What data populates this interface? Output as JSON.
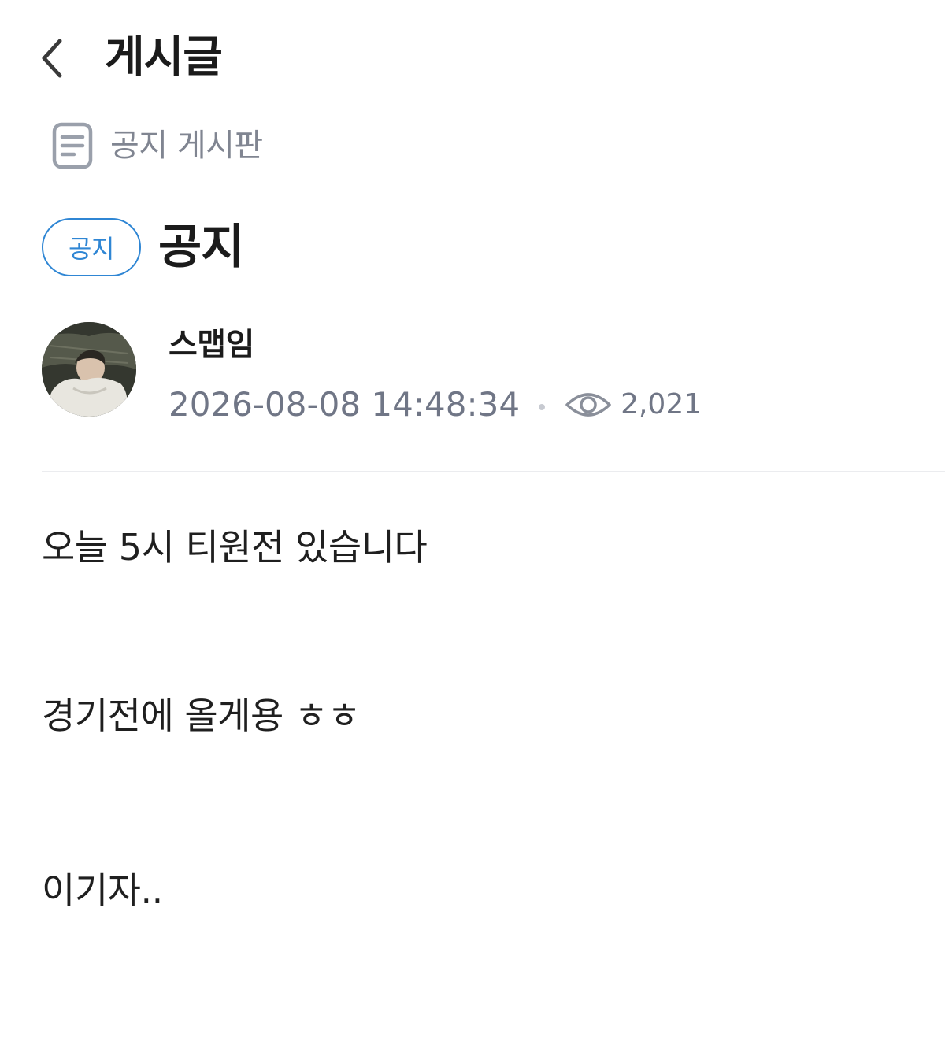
{
  "header": {
    "title": "게시글",
    "back_icon": "chevron-left-icon"
  },
  "board": {
    "icon": "document-icon",
    "name": "공지 게시판"
  },
  "post": {
    "badge": "공지",
    "title": "공지",
    "author": {
      "name": "스맵임",
      "avatar": "avatar"
    },
    "datetime": "2026-08-08 14:48:34",
    "views_icon": "eye-icon",
    "views": "2,021",
    "body": [
      "오늘 5시 티원전 있습니다",
      "경기전에 올게용 ㅎㅎ",
      "이기자.."
    ]
  },
  "colors": {
    "accent": "#2f86d4",
    "meta_text": "#707686",
    "board_text": "#808591",
    "divider": "#ebecef"
  }
}
